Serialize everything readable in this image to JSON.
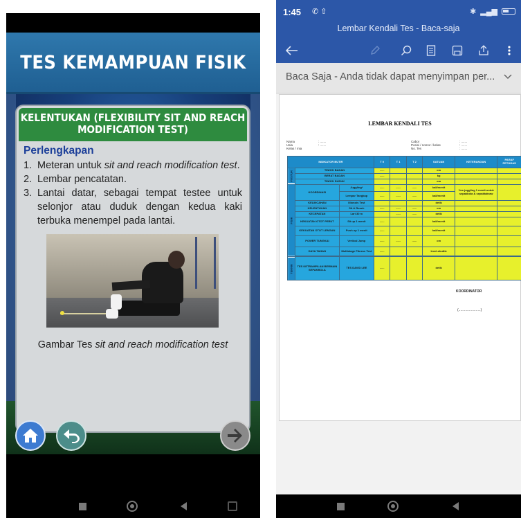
{
  "left_app": {
    "title": "TES KEMAMPUAN FISIK",
    "card_title": "KELENTUKAN (FLEXIBILITY SIT AND REACH MODIFICATION TEST)",
    "subheading": "Perlengkapan",
    "items": [
      {
        "num": "1.",
        "text_before": "Meteran untuk ",
        "text_italic": "sit and reach modification test",
        "text_after": "."
      },
      {
        "num": "2.",
        "text_before": "Lembar pencatatan.",
        "text_italic": "",
        "text_after": ""
      },
      {
        "num": "3.",
        "text_before": "Lantai datar, sebagai tempat testee untuk selonjor atau duduk dengan kedua kaki terbuka menempel pada lantai.",
        "text_italic": "",
        "text_after": ""
      }
    ],
    "caption_before": "Gambar Tes ",
    "caption_italic": "sit and reach modification test",
    "buttons": {
      "home": "home-icon",
      "back": "back-arrow-icon",
      "next": "right-arrow-icon"
    },
    "colors": {
      "titlebar": "#2f78ad",
      "card_header": "#2e8b3f",
      "card_bg": "#d6d9db"
    }
  },
  "right_app": {
    "status_time": "1:45",
    "title": "Lembar Kendali Tes - Baca-saja",
    "banner": "Baca Saja - Anda tidak dapat menyimpan per...",
    "doc": {
      "title": "LEMBAR KENDALI TES",
      "meta_left": [
        "Nama",
        "Usia",
        "Kelas / mia"
      ],
      "meta_right": [
        "Cabor",
        "Posisi / nomor / kelas",
        "No. Tes"
      ],
      "meta_fill": ": .......",
      "headers": [
        "INDIKATOR BUTIR",
        "T 0",
        "T 1",
        "T 2",
        "SATUAN",
        "KETERANGAN",
        "PARAF PETUGAS"
      ],
      "categories": [
        "POSTUR",
        "FISIK",
        "TEKNIK"
      ],
      "postur_rows": [
        {
          "label": "TINGGI BADAN",
          "satuan": "cm",
          "t0": "......"
        },
        {
          "label": "BERAT BADAN",
          "satuan": "kg",
          "t0": "......"
        },
        {
          "label": "TINGGI DUDUK",
          "satuan": "cm",
          "t0": ""
        }
      ],
      "fisik_rows": [
        {
          "group": "KOORDINASI",
          "label": "Juggling*",
          "satuan": "kali/menit",
          "t0": "......",
          "t1": "......",
          "t2": "......"
        },
        {
          "group": "",
          "label": "Lempar Tangkap",
          "satuan": "kali/menit",
          "t0": "......",
          "t1": "......",
          "t2": "......"
        },
        {
          "group": "KELINCAHAN",
          "label": "Illionois Test",
          "satuan": "detik",
          "t0": "",
          "t1": "",
          "t2": ""
        },
        {
          "group": "KELENTUKAN",
          "label": "Sit & Reach",
          "satuan": "cm",
          "t0": "......",
          "t1": "......",
          "t2": "......"
        },
        {
          "group": "KECEPATAN",
          "label": "Lari 30 m",
          "satuan": "detik",
          "t0": "",
          "t1": "......",
          "t2": "......"
        },
        {
          "group": "KEKUATAN OTOT PERUT",
          "label": "Sit up 1 menit",
          "satuan": "kali/menit",
          "t0": "......",
          "t1": "",
          "t2": ""
        },
        {
          "group": "KEKUATAN OTOT LENGAN",
          "label": "Push up 1 menit",
          "satuan": "kali/menit",
          "t0": "......",
          "t1": "",
          "t2": ""
        },
        {
          "group": "POWER TUNGKAI",
          "label": "Vertical Jump",
          "satuan": "cm",
          "t0": "......",
          "t1": "......",
          "t2": "......"
        },
        {
          "group": "DAYA TAHAN",
          "label": "Multistage Fitness Test",
          "satuan": "level-shuttle",
          "t0": "......",
          "t1": "",
          "t2": ""
        }
      ],
      "koordinasi_note": "*tes juggling 1 menit untuk sepakbola & sepaktakraw",
      "teknik_row": {
        "group": "TES KETRAMPILAN BERMAIN SEPAKBOLA",
        "label": "TES DAVID LEE",
        "satuan": "detik",
        "t0": "......"
      },
      "koordinator": "KOORDINATOR",
      "signature": "(.......................)"
    },
    "colors": {
      "header": "#2c57a8",
      "table_blue": "#26a6de",
      "table_yellow": "#e7f02c"
    }
  }
}
